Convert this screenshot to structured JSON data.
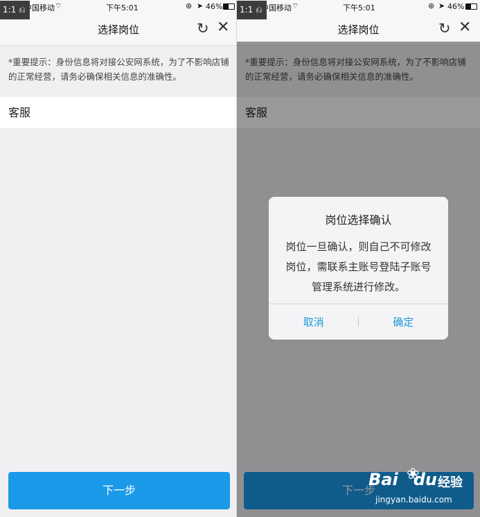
{
  "statusbar": {
    "zoom_badge": "1:1 ⎌",
    "signal": "●●●●○",
    "carrier": "中国移动",
    "time": "下午5:01",
    "battery_pct": "46%"
  },
  "navbar": {
    "title": "选择岗位",
    "refresh_icon": "refresh-icon",
    "close_icon": "close-icon"
  },
  "notice": "*重要提示：身份信息将对接公安网系统，为了不影响店铺的正常经营，请务必确保相关信息的准确性。",
  "list": {
    "items": [
      {
        "label": "客服"
      }
    ]
  },
  "next_button": {
    "label": "下一步"
  },
  "dialog": {
    "title": "岗位选择确认",
    "message": "岗位一旦确认，则自己不可修改岗位，需联系主账号登陆子账号管理系统进行修改。",
    "cancel_label": "取消",
    "confirm_label": "确定"
  },
  "watermark": {
    "logo": "Bai",
    "logo_suffix": "du",
    "product": "经验",
    "url": "jingyan.baidu.com"
  },
  "colors": {
    "accent": "#1a9ae8",
    "dialog_button": "#1d9ad9",
    "overlay": "rgba(0,0,0,0.4)"
  }
}
